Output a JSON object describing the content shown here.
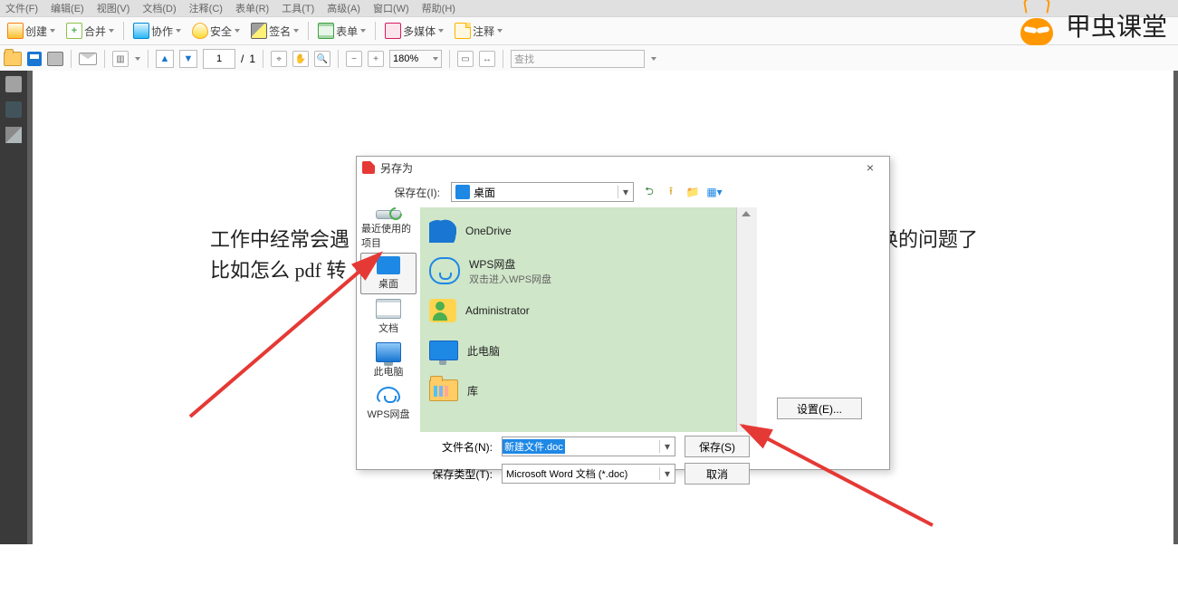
{
  "menu": [
    "文件(F)",
    "编辑(E)",
    "视图(V)",
    "文档(D)",
    "注释(C)",
    "表单(R)",
    "工具(T)",
    "高级(A)",
    "窗口(W)",
    "帮助(H)"
  ],
  "tb1": {
    "create": "创建",
    "merge": "合并",
    "collab": "协作",
    "secure": "安全",
    "sign": "签名",
    "forms": "表单",
    "mm": "多媒体",
    "note": "注释"
  },
  "tb2": {
    "page_cur": "1",
    "page_total": "1",
    "zoom": "180%",
    "find": "查找"
  },
  "watermark": "甲虫课堂",
  "doc": {
    "l1": "工作中经常会遇",
    "l1b": "式转换的问题了",
    "l2": "比如怎么 pdf 转"
  },
  "dlg": {
    "title": "另存为",
    "save_in": "保存在(I):",
    "save_in_val": "桌面",
    "places": [
      "最近使用的项目",
      "桌面",
      "文档",
      "此电脑",
      "WPS网盘"
    ],
    "items": [
      {
        "name": "OneDrive"
      },
      {
        "name": "WPS网盘",
        "sub": "双击进入WPS网盘"
      },
      {
        "name": "Administrator"
      },
      {
        "name": "此电脑"
      },
      {
        "name": "库"
      }
    ],
    "fn_lbl": "文件名(N):",
    "fn_val": "新建文件.doc",
    "ft_lbl": "保存类型(T):",
    "ft_val": "Microsoft Word 文档 (*.doc)",
    "save": "保存(S)",
    "cancel": "取消",
    "settings": "设置(E)..."
  }
}
